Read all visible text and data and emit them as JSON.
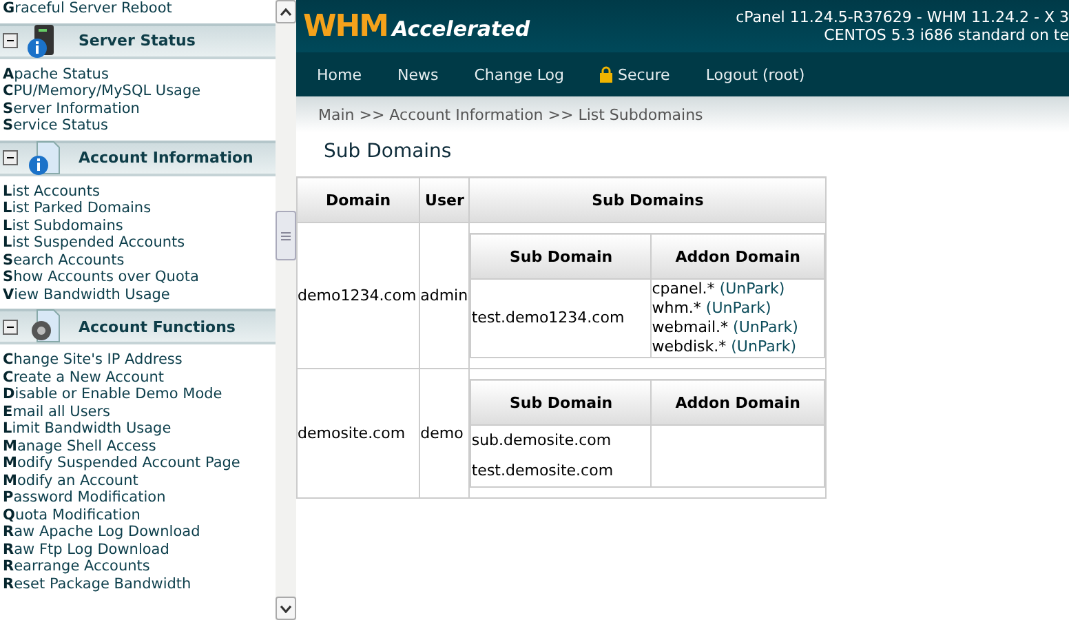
{
  "sidebar": {
    "top_item": "**G**raceful Server Reboot",
    "sections": [
      {
        "title": "Server Status",
        "expanded": true,
        "items": [
          "**A**pache Status",
          "**C**PU/Memory/MySQL Usage",
          "**S**erver Information",
          "**S**ervice Status"
        ]
      },
      {
        "title": "Account Information",
        "expanded": true,
        "items": [
          "**L**ist Accounts",
          "**L**ist Parked Domains",
          "**L**ist Subdomains",
          "**L**ist Suspended Accounts",
          "**S**earch Accounts",
          "**S**how Accounts over Quota",
          "**V**iew Bandwidth Usage"
        ]
      },
      {
        "title": "Account Functions",
        "expanded": true,
        "items": [
          "**C**hange Site's IP Address",
          "**C**reate a New Account",
          "**D**isable or Enable Demo Mode",
          "**E**mail all Users",
          "**L**imit Bandwidth Usage",
          "**M**anage Shell Access",
          "**M**odify Suspended Account Page",
          "**M**odify an Account",
          "**P**assword Modification",
          "**Q**uota Modification",
          "**R**aw Apache Log Download",
          "**R**aw Ftp Log Download",
          "**R**earrange Accounts",
          "**R**eset Package Bandwidth"
        ]
      }
    ]
  },
  "header": {
    "logo_main": "WHM",
    "logo_sub": "Accelerated",
    "version_line": "cPanel 11.24.5-R37629 - WHM 11.24.2 - X 3",
    "os_line": "CENTOS 5.3 i686 standard on te"
  },
  "nav": [
    {
      "label": "Home",
      "kind": "plain"
    },
    {
      "label": "News",
      "kind": "plain"
    },
    {
      "label": "Change Log",
      "kind": "plain"
    },
    {
      "label": "Secure",
      "kind": "lock"
    },
    {
      "label": "Logout (root)",
      "kind": "plain"
    }
  ],
  "breadcrumb": "Main >> Account Information >> List Subdomains",
  "page_title": "Sub Domains",
  "table": {
    "columns": [
      "Domain",
      "User",
      "Sub Domains"
    ],
    "rows": [
      {
        "domain": "demo1234.com",
        "user": "admin",
        "sub_columns": [
          "Sub Domain",
          "Addon Domain"
        ],
        "subdomains": [
          "test.demo1234.com"
        ],
        "addons": [
          {
            "name": "cpanel.*",
            "action": "(UnPark)"
          },
          {
            "name": "whm.*",
            "action": "(UnPark)"
          },
          {
            "name": "webmail.*",
            "action": "(UnPark)"
          },
          {
            "name": "webdisk.*",
            "action": "(UnPark)"
          }
        ]
      },
      {
        "domain": "demosite.com",
        "user": "demo",
        "sub_columns": [
          "Sub Domain",
          "Addon Domain"
        ],
        "subdomains": [
          "sub.demosite.com",
          "test.demosite.com"
        ],
        "addons": []
      }
    ]
  }
}
